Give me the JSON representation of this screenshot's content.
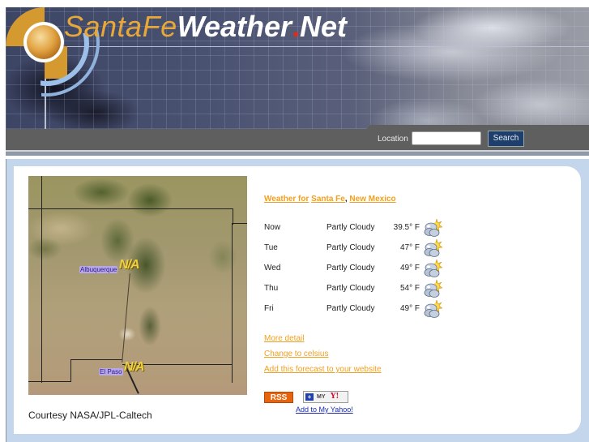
{
  "header": {
    "site_title_part1": "SantaFe",
    "site_title_part2": "Weather",
    "site_title_dot": ".",
    "site_title_part3": "Net",
    "search": {
      "label": "Location",
      "input_value": "",
      "input_placeholder": "",
      "button_label": "Search"
    }
  },
  "map": {
    "labels": [
      {
        "city": "Albuquerque",
        "value": "N/A"
      },
      {
        "city": "El Paso",
        "value": "N/A"
      }
    ],
    "courtesy": "Courtesy NASA/JPL-Caltech"
  },
  "forecast": {
    "heading_prefix": "Weather for",
    "city": "Santa Fe",
    "separator": ",",
    "state": "New Mexico",
    "rows": [
      {
        "day": "Now",
        "condition": "Partly Cloudy",
        "temp": "39.5° F",
        "icon": "partly-cloudy-icon"
      },
      {
        "day": "Tue",
        "condition": "Partly Cloudy",
        "temp": "47° F",
        "icon": "partly-cloudy-icon"
      },
      {
        "day": "Wed",
        "condition": "Partly Cloudy",
        "temp": "49° F",
        "icon": "partly-cloudy-icon"
      },
      {
        "day": "Thu",
        "condition": "Partly Cloudy",
        "temp": "54° F",
        "icon": "partly-cloudy-icon"
      },
      {
        "day": "Fri",
        "condition": "Partly Cloudy",
        "temp": "49° F",
        "icon": "partly-cloudy-icon"
      }
    ]
  },
  "links": {
    "more_detail": "More detail",
    "change_units": "Change to celsius",
    "add_forecast": "Add this forecast to your website"
  },
  "feeds": {
    "rss_label": "RSS",
    "myyahoo_plus": "+",
    "myyahoo_my": "MY",
    "myyahoo_y": "Y!",
    "add_to_yahoo": "Add to My Yahoo!"
  },
  "colors": {
    "link_orange": "#f0a020",
    "search_button": "#1e3f6c",
    "frame_blue": "#c4d6ec",
    "rss_orange": "#e8640c"
  }
}
